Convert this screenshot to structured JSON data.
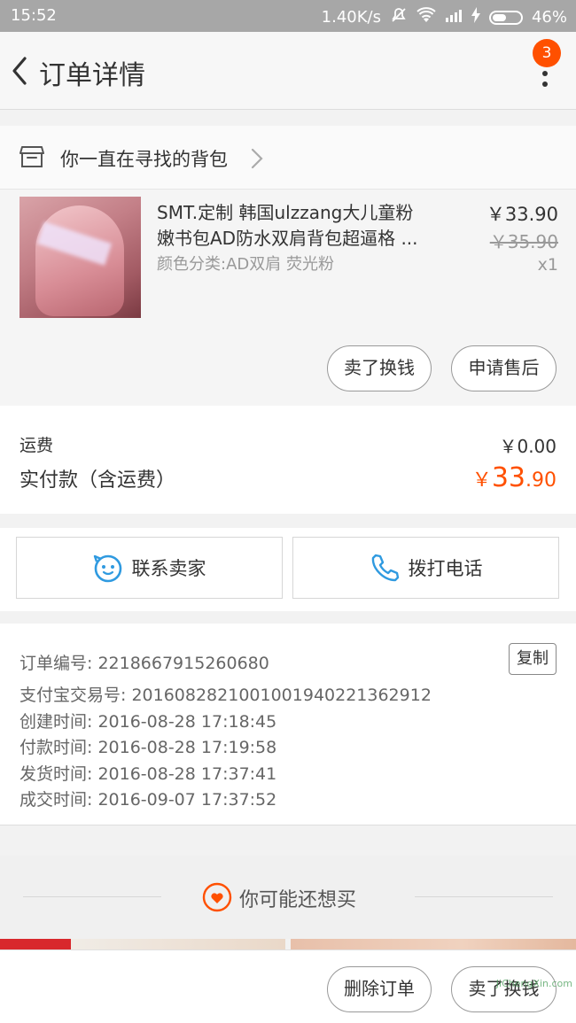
{
  "status_bar": {
    "time": "15:52",
    "speed": "1.40K/s",
    "battery": "46%"
  },
  "nav": {
    "title": "订单详情",
    "badge": "3"
  },
  "shop": {
    "name": "你一直在寻找的背包"
  },
  "product": {
    "title_line1": "SMT.定制 韩国ulzzang大儿童粉",
    "title_line2": "嫩书包AD防水双肩背包超逼格 ...",
    "sku": "颜色分类:AD双肩 荧光粉",
    "price": "￥33.90",
    "original_price": "￥35.90",
    "quantity": "x1",
    "sell_label": "卖了换钱",
    "after_sale_label": "申请售后"
  },
  "fees": {
    "shipping_label": "运费",
    "shipping_value": "￥0.00",
    "paid_label": "实付款（含运费）",
    "paid_currency": "￥",
    "paid_int": "33",
    "paid_dec": ".90"
  },
  "contact": {
    "seller_label": "联系卖家",
    "call_label": "拨打电话"
  },
  "order_info": {
    "copy_label": "复制",
    "rows": [
      "订单编号: 2218667915260680",
      "支付宝交易号: 2016082821001001940221362912",
      "创建时间: 2016-08-28 17:18:45",
      "付款时间: 2016-08-28 17:19:58",
      "发货时间: 2016-08-28 17:37:41",
      "成交时间: 2016-09-07 17:37:52"
    ]
  },
  "recommend": {
    "title": "你可能还想买"
  },
  "bottom": {
    "delete_label": "删除订单",
    "sell_label": "卖了换钱"
  },
  "watermark": "JiChengXin.com",
  "colors": {
    "accent": "#ff5000",
    "contact_icon": "#2f9ae0"
  }
}
